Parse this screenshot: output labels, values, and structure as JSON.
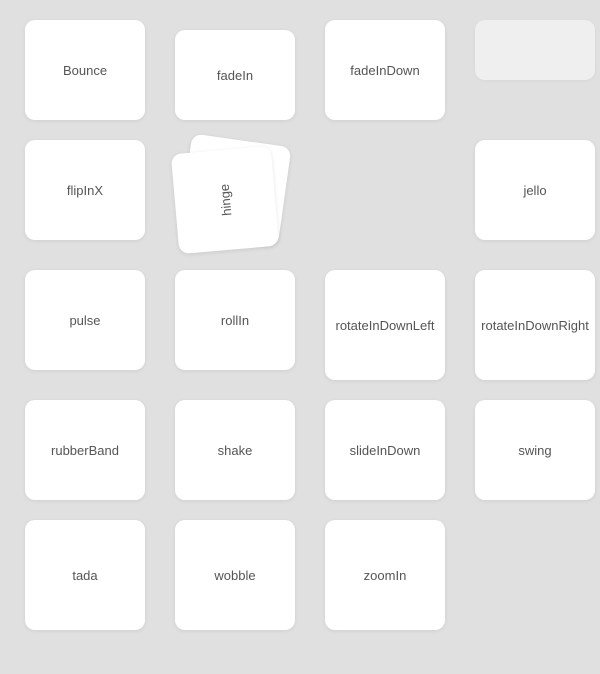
{
  "cards": {
    "bounce": "Bounce",
    "fadeIn": "fadeIn",
    "fadeInDown": "fadeInDown",
    "flipInX": "flipInX",
    "hinge": "hinge",
    "jello": "jello",
    "pulse": "pulse",
    "rollIn": "rollIn",
    "rotateInDownLeft": "rotateInDownLeft",
    "rotateInDownRight": "rotateInDownRight",
    "rubberBand": "rubberBand",
    "shake": "shake",
    "slideInDown": "slideInDown",
    "swing": "swing",
    "tada": "tada",
    "wobble": "wobble",
    "zoomIn": "zoomIn"
  }
}
